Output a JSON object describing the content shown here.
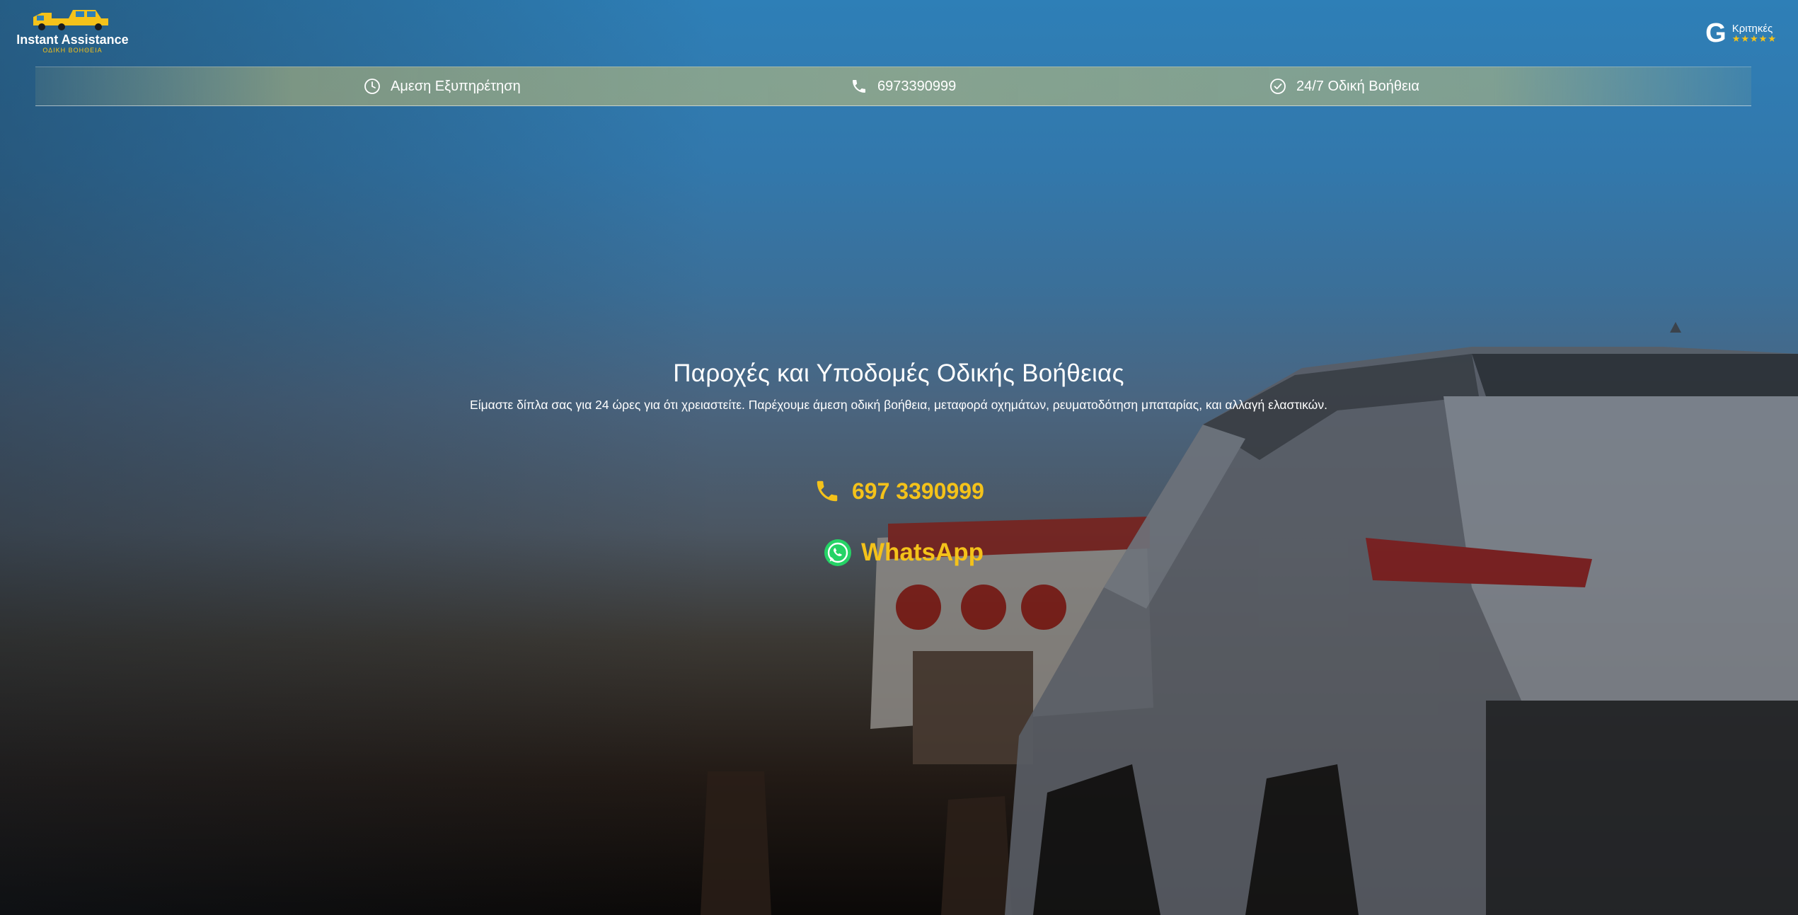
{
  "brand": {
    "name": "Instant Assistance",
    "tagline": "ΟΔΙΚΗ ΒΟΗΘΕΙΑ",
    "logo_icon": "tow-truck-icon"
  },
  "reviews": {
    "icon": "google-g-icon",
    "g_glyph": "G",
    "label": "Κριτηκές",
    "stars": "★★★★★",
    "star_color": "#f4c21a"
  },
  "info_bar": {
    "items": [
      {
        "icon": "clock-icon",
        "label": "Αμεση Εξυπηρέτηση"
      },
      {
        "icon": "phone-icon",
        "label": "6973390999"
      },
      {
        "icon": "check-circle-icon",
        "label": "24/7 Οδική Βοήθεια"
      }
    ]
  },
  "hero": {
    "title": "Παροχές και Υποδομές Οδικής Βοήθειας",
    "description": "Είμαστε δίπλα σας για 24 ώρες για ότι χρειαστείτε. Παρέχουμε άμεση οδική βοήθεια, μεταφορά οχημάτων, ρευματοδότηση μπαταρίας, και αλλαγή ελαστικών."
  },
  "cta": {
    "phone_label": "697 3390999",
    "phone_icon": "phone-icon",
    "whatsapp_label": "WhatsApp",
    "whatsapp_icon": "whatsapp-icon"
  },
  "colors": {
    "accent": "#f4c21a",
    "text": "#ffffff",
    "whatsapp_green": "#25d366"
  }
}
